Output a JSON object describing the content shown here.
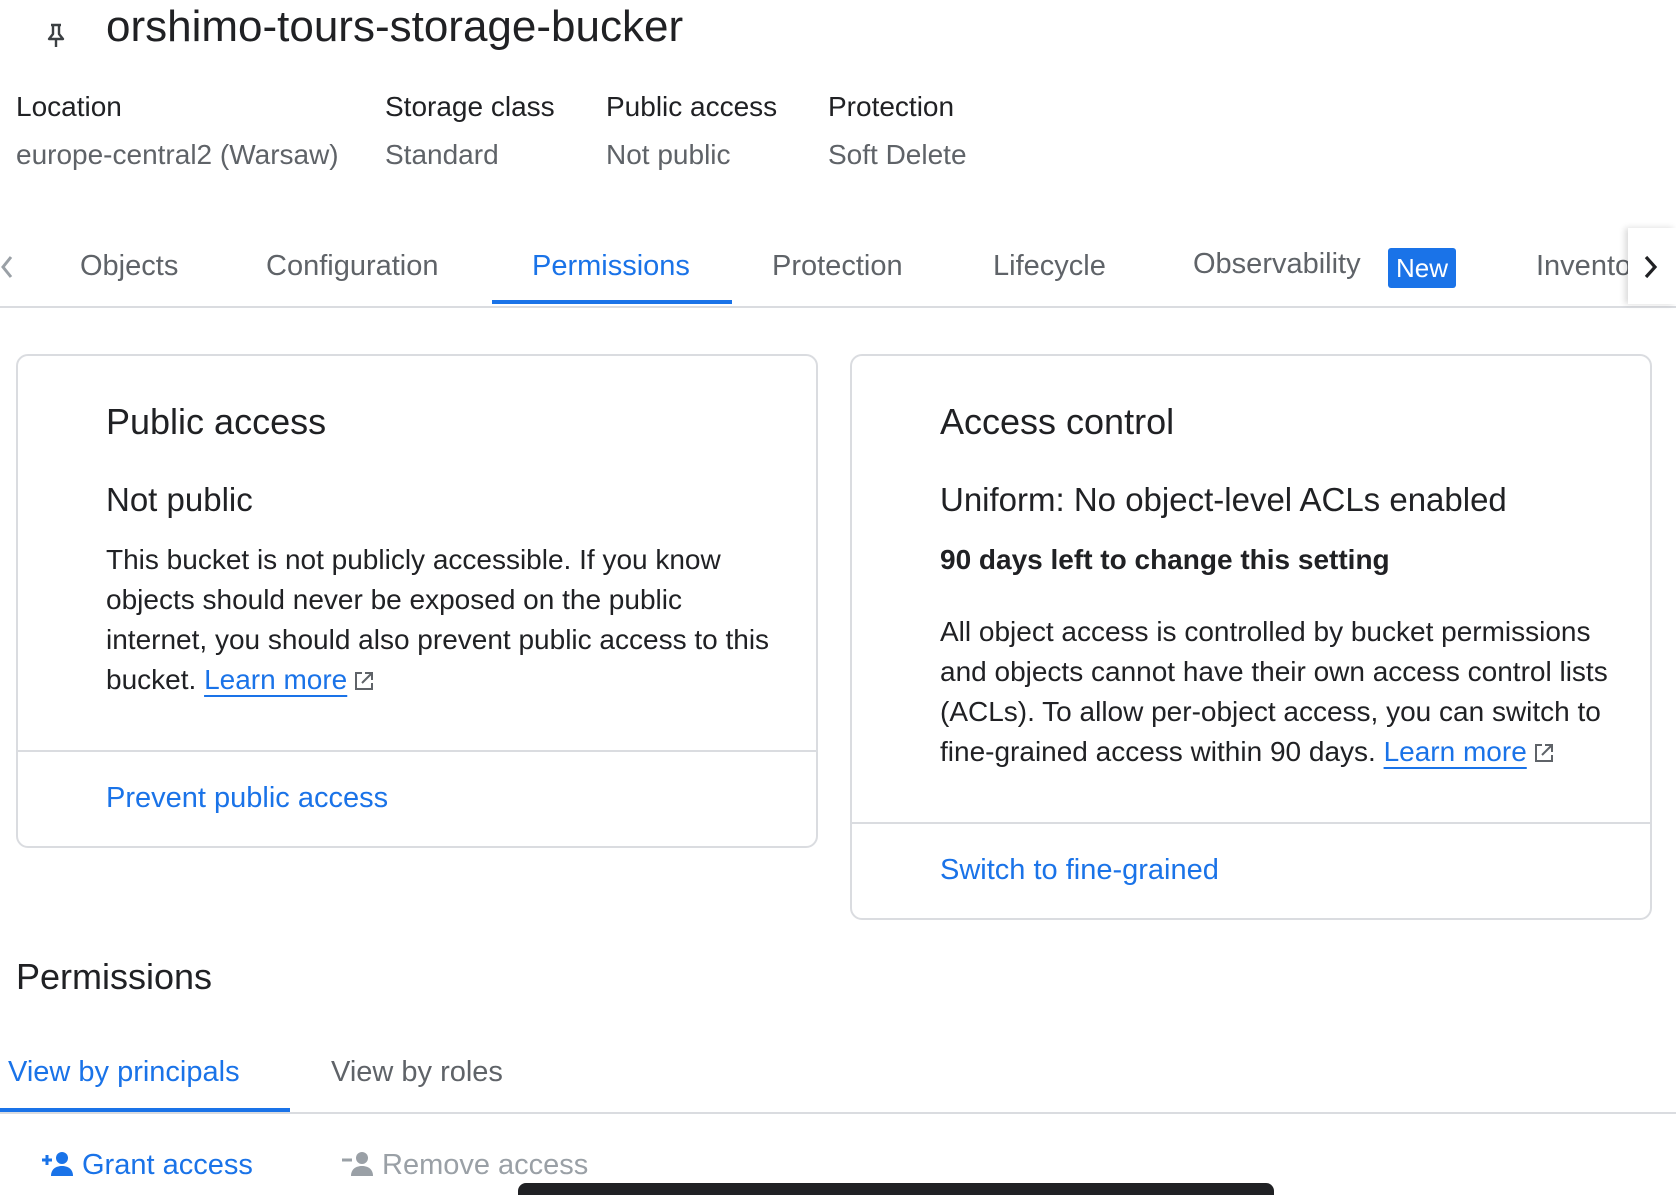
{
  "bucket": {
    "name": "orshimo-tours-storage-bucker"
  },
  "meta": {
    "location": {
      "label": "Location",
      "value": "europe-central2 (Warsaw)"
    },
    "storage_class": {
      "label": "Storage class",
      "value": "Standard"
    },
    "public_access": {
      "label": "Public access",
      "value": "Not public"
    },
    "protection": {
      "label": "Protection",
      "value": "Soft Delete"
    }
  },
  "tabs": {
    "items": [
      "Objects",
      "Configuration",
      "Permissions",
      "Protection",
      "Lifecycle",
      "Observability",
      "Invento"
    ],
    "active": "Permissions",
    "new_badge": "New"
  },
  "public_access_card": {
    "title": "Public access",
    "status": "Not public",
    "description": "This bucket is not publicly accessible. If you know objects should never be exposed on the public internet, you should also prevent public access to this bucket.",
    "learn_more": "Learn more",
    "action": "Prevent public access"
  },
  "access_control_card": {
    "title": "Access control",
    "status": "Uniform: No object-level ACLs enabled",
    "note": "90 days left to change this setting",
    "description": "All object access is controlled by bucket permissions and objects cannot have their own access control lists (ACLs). To allow per-object access, you can switch to fine-grained access within 90 days.",
    "learn_more": "Learn more",
    "action": "Switch to fine-grained"
  },
  "permissions": {
    "title": "Permissions",
    "view_tabs": [
      "View by principals",
      "View by roles"
    ],
    "active_view": "View by principals",
    "grant_access": "Grant access",
    "remove_access": "Remove access"
  },
  "colors": {
    "accent": "#1a73e8",
    "text_primary": "#202124",
    "text_secondary": "#5f6368",
    "disabled": "#9aa0a6",
    "divider": "#dadce0"
  },
  "icons": [
    "pin-icon",
    "chevron-left-icon",
    "chevron-right-icon",
    "external-link-icon",
    "person-add-icon",
    "person-remove-icon"
  ]
}
